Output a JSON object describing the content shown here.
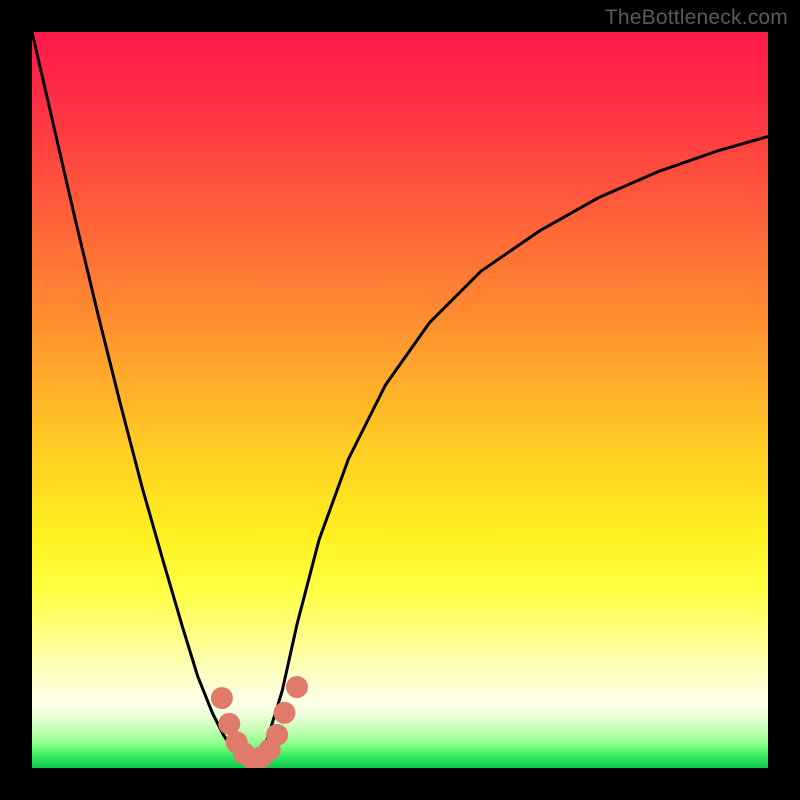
{
  "watermark": "TheBottleneck.com",
  "chart_data": {
    "type": "line",
    "title": "",
    "xlabel": "",
    "ylabel": "",
    "xlim": [
      0,
      1
    ],
    "ylim": [
      0,
      1
    ],
    "series": [
      {
        "name": "curve-left",
        "x": [
          0.0,
          0.03,
          0.06,
          0.09,
          0.12,
          0.15,
          0.18,
          0.205,
          0.225,
          0.245,
          0.26,
          0.27,
          0.28,
          0.29,
          0.3
        ],
        "y": [
          1.0,
          0.87,
          0.74,
          0.615,
          0.495,
          0.38,
          0.275,
          0.19,
          0.125,
          0.075,
          0.045,
          0.03,
          0.02,
          0.012,
          0.01
        ]
      },
      {
        "name": "curve-right",
        "x": [
          0.3,
          0.32,
          0.34,
          0.36,
          0.39,
          0.43,
          0.48,
          0.54,
          0.61,
          0.69,
          0.77,
          0.85,
          0.93,
          1.0
        ],
        "y": [
          0.01,
          0.04,
          0.105,
          0.195,
          0.31,
          0.42,
          0.52,
          0.605,
          0.675,
          0.73,
          0.775,
          0.81,
          0.838,
          0.858
        ]
      },
      {
        "name": "marker-cluster",
        "x": [
          0.258,
          0.268,
          0.278,
          0.288,
          0.3,
          0.312,
          0.323,
          0.333,
          0.343,
          0.36
        ],
        "y": [
          0.095,
          0.06,
          0.035,
          0.02,
          0.012,
          0.015,
          0.025,
          0.045,
          0.075,
          0.11
        ]
      }
    ],
    "marker_color": "#e07a6a",
    "line_color": "#000000"
  }
}
